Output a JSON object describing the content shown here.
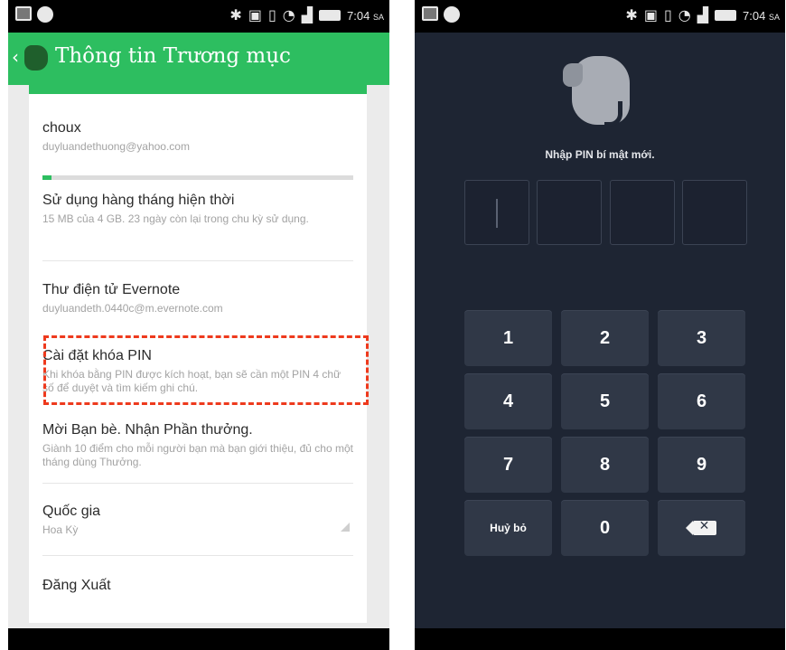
{
  "status_bar": {
    "time": "7:04",
    "time_suffix": "SA",
    "icons": [
      "gallery-icon",
      "messenger-icon",
      "bluetooth-icon",
      "nfc-icon",
      "vibrate-icon",
      "wifi-icon",
      "signal-icon",
      "battery-icon"
    ]
  },
  "left_screen": {
    "header": {
      "back_glyph": "‹",
      "title": "Thông tin Trương mục",
      "color": "#2dbe60"
    },
    "account": {
      "username": "choux",
      "email": "duyluandethuong@yahoo.com"
    },
    "usage": {
      "progress_fraction": 0.03,
      "title": "Sử dụng hàng tháng hiện thời",
      "description": "15 MB của 4 GB. 23 ngày còn lại trong chu kỳ sử dụng."
    },
    "evernote_email": {
      "title": "Thư điện tử Evernote",
      "value": "duyluandeth.0440c@m.evernote.com"
    },
    "pin_lock": {
      "title": "Cài đặt khóa PIN",
      "description": "Khi khóa bằng PIN được kích hoạt, bạn sẽ cần một PIN 4 chữ số để duyệt và tìm kiếm ghi chú.",
      "highlight_color": "#ee3a1d"
    },
    "invite": {
      "title": "Mời Bạn bè. Nhận Phần thưởng.",
      "description": "Giành 10 điểm cho mỗi người bạn mà bạn giới thiệu, đủ cho một tháng dùng Thưởng."
    },
    "country": {
      "title": "Quốc gia",
      "value": "Hoa Kỳ"
    },
    "logout": {
      "label": "Đăng Xuất"
    }
  },
  "right_screen": {
    "prompt": "Nhập PIN bí mật mới.",
    "pin_slots": 4,
    "keypad": {
      "digits": [
        "1",
        "2",
        "3",
        "4",
        "5",
        "6",
        "7",
        "8",
        "9"
      ],
      "cancel_label": "Huỷ bỏ",
      "zero": "0",
      "delete_glyph": "✕"
    },
    "background_color": "#1e2533"
  }
}
